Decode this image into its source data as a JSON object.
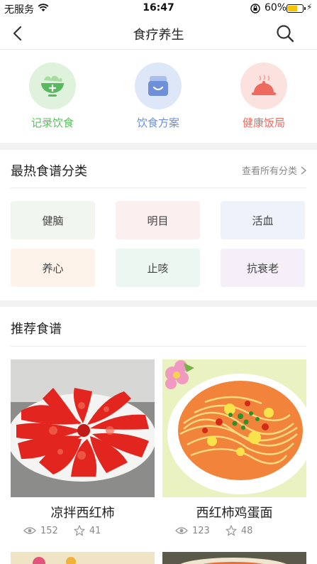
{
  "status_bar": {
    "carrier": "无服务",
    "time": "16:47",
    "battery": "60%"
  },
  "nav": {
    "title": "食疗养生"
  },
  "quick_actions": [
    {
      "label": "记录饮食",
      "color": "#5cbf5c",
      "bg": "#dff2dc",
      "icon": "bowl-icon"
    },
    {
      "label": "饮食方案",
      "color": "#6f8fd8",
      "bg": "#dde7f7",
      "icon": "lunchbox-icon"
    },
    {
      "label": "健康饭局",
      "color": "#ee6a5e",
      "bg": "#fbe2de",
      "icon": "cloche-icon"
    }
  ],
  "hot": {
    "title": "最热食谱分类",
    "see_all": "查看所有分类",
    "tags": [
      {
        "label": "健脑",
        "bg": "#f1f6ef"
      },
      {
        "label": "明目",
        "bg": "#fbf0ef"
      },
      {
        "label": "活血",
        "bg": "#eef2fb"
      },
      {
        "label": "养心",
        "bg": "#fdf3ea"
      },
      {
        "label": "止咳",
        "bg": "#ecf7f1"
      },
      {
        "label": "抗衰老",
        "bg": "#f4eff8"
      }
    ]
  },
  "recommend": {
    "title": "推荐食谱",
    "cards": [
      {
        "name": "凉拌西红柿",
        "views": "152",
        "stars": "41"
      },
      {
        "name": "西红柿鸡蛋面",
        "views": "123",
        "stars": "48"
      }
    ]
  }
}
